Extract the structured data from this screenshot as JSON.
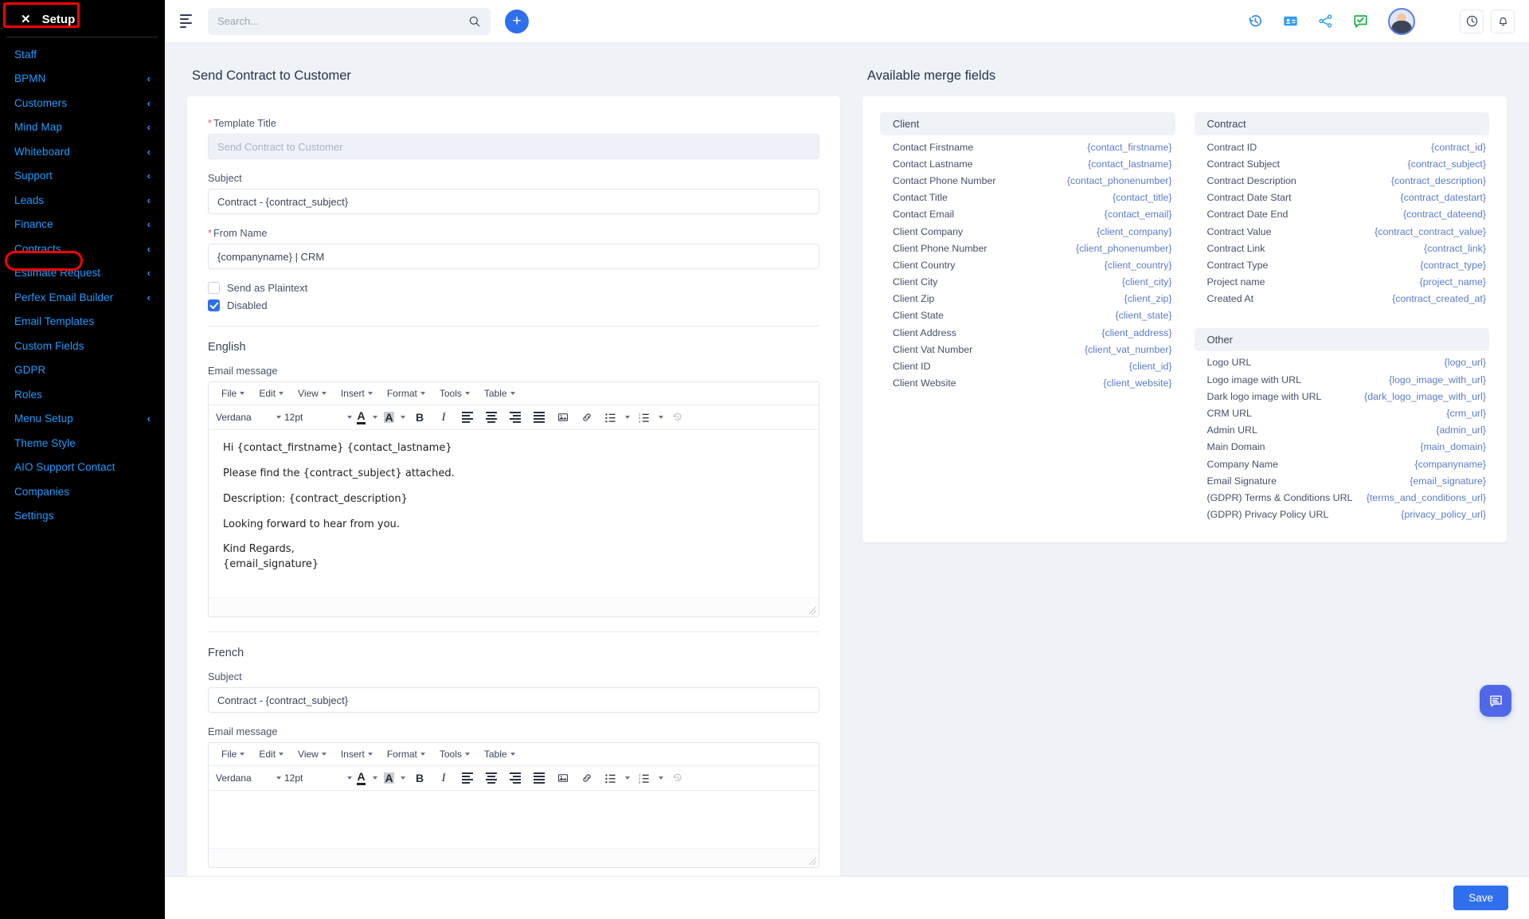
{
  "sidebar": {
    "header": {
      "label": "Setup",
      "close_icon": "close-icon"
    },
    "items": [
      {
        "label": "Staff",
        "has_chevron": false
      },
      {
        "label": "BPMN",
        "has_chevron": true
      },
      {
        "label": "Customers",
        "has_chevron": true
      },
      {
        "label": "Mind Map",
        "has_chevron": true
      },
      {
        "label": "Whiteboard",
        "has_chevron": true
      },
      {
        "label": "Support",
        "has_chevron": true
      },
      {
        "label": "Leads",
        "has_chevron": true
      },
      {
        "label": "Finance",
        "has_chevron": true
      },
      {
        "label": "Contracts",
        "has_chevron": true
      },
      {
        "label": "Estimate Request",
        "has_chevron": true
      },
      {
        "label": "Perfex Email Builder",
        "has_chevron": true
      },
      {
        "label": "Email Templates",
        "has_chevron": false
      },
      {
        "label": "Custom Fields",
        "has_chevron": false
      },
      {
        "label": "GDPR",
        "has_chevron": false
      },
      {
        "label": "Roles",
        "has_chevron": false
      },
      {
        "label": "Menu Setup",
        "has_chevron": true
      },
      {
        "label": "Theme Style",
        "has_chevron": false
      },
      {
        "label": "AIO Support Contact",
        "has_chevron": false
      },
      {
        "label": "Companies",
        "has_chevron": false
      },
      {
        "label": "Settings",
        "has_chevron": false
      }
    ],
    "chevron_glyph": "‹",
    "highlight_color": "#ff0000",
    "link_color": "#1e9bff",
    "background": "#000000"
  },
  "topbar": {
    "menu_toggle": "hamburger-icon",
    "search": {
      "placeholder": "Search...",
      "value": ""
    },
    "add_button_label": "+",
    "icons": [
      "history-icon",
      "contact-card-icon",
      "share-icon",
      "green-chat-icon",
      "avatar",
      "clock-icon",
      "bell-icon"
    ],
    "accent_color": "#2f6fed"
  },
  "main": {
    "page_title": "Send Contract to Customer",
    "form": {
      "template_title": {
        "label": "Template Title",
        "required": true,
        "value": "",
        "placeholder": "Send Contract to Customer",
        "disabled": true
      },
      "subject": {
        "label": "Subject",
        "required": false,
        "value": "Contract - {contract_subject}"
      },
      "from_name": {
        "label": "From Name",
        "required": true,
        "value": "{companyname} | CRM"
      },
      "checkboxes": [
        {
          "label": "Send as Plaintext",
          "checked": false
        },
        {
          "label": "Disabled",
          "checked": true
        }
      ]
    },
    "languages": [
      {
        "name": "English",
        "message_label": "Email message",
        "subject_label": "",
        "subject_value": "",
        "show_subject": false,
        "body": [
          "Hi {contact_firstname} {contact_lastname}",
          "Please find the {contract_subject} attached.",
          "Description: {contract_description}",
          "Looking forward to hear from you.",
          "Kind Regards,",
          "{email_signature}"
        ]
      },
      {
        "name": "French",
        "message_label": "Email message",
        "subject_label": "Subject",
        "subject_value": "Contract - {contract_subject}",
        "show_subject": true,
        "body": []
      }
    ],
    "editor": {
      "menus": [
        "File",
        "Edit",
        "View",
        "Insert",
        "Format",
        "Tools",
        "Table"
      ],
      "font_family": "Verdana",
      "font_size": "12pt",
      "buttons": [
        "text-color-icon",
        "background-color-icon",
        "bold-icon",
        "italic-icon",
        "align-left-icon",
        "align-center-icon",
        "align-right-icon",
        "align-justify-icon",
        "image-icon",
        "link-icon",
        "bullet-list-icon",
        "numbered-list-icon",
        "undo-icon"
      ]
    }
  },
  "merge_fields": {
    "title": "Available merge fields",
    "groups": [
      {
        "name": "Client",
        "column": 1,
        "rows": [
          {
            "name": "Contact Firstname",
            "key": "{contact_firstname}"
          },
          {
            "name": "Contact Lastname",
            "key": "{contact_lastname}"
          },
          {
            "name": "Contact Phone Number",
            "key": "{contact_phonenumber}"
          },
          {
            "name": "Contact Title",
            "key": "{contact_title}"
          },
          {
            "name": "Contact Email",
            "key": "{contact_email}"
          },
          {
            "name": "Client Company",
            "key": "{client_company}"
          },
          {
            "name": "Client Phone Number",
            "key": "{client_phonenumber}"
          },
          {
            "name": "Client Country",
            "key": "{client_country}"
          },
          {
            "name": "Client City",
            "key": "{client_city}"
          },
          {
            "name": "Client Zip",
            "key": "{client_zip}"
          },
          {
            "name": "Client State",
            "key": "{client_state}"
          },
          {
            "name": "Client Address",
            "key": "{client_address}"
          },
          {
            "name": "Client Vat Number",
            "key": "{client_vat_number}"
          },
          {
            "name": "Client ID",
            "key": "{client_id}"
          },
          {
            "name": "Client Website",
            "key": "{client_website}"
          }
        ]
      },
      {
        "name": "Contract",
        "column": 2,
        "rows": [
          {
            "name": "Contract ID",
            "key": "{contract_id}"
          },
          {
            "name": "Contract Subject",
            "key": "{contract_subject}"
          },
          {
            "name": "Contract Description",
            "key": "{contract_description}"
          },
          {
            "name": "Contract Date Start",
            "key": "{contract_datestart}"
          },
          {
            "name": "Contract Date End",
            "key": "{contract_dateend}"
          },
          {
            "name": "Contract Value",
            "key": "{contract_contract_value}"
          },
          {
            "name": "Contract Link",
            "key": "{contract_link}"
          },
          {
            "name": "Contract Type",
            "key": "{contract_type}"
          },
          {
            "name": "Project name",
            "key": "{project_name}"
          },
          {
            "name": "Created At",
            "key": "{contract_created_at}"
          }
        ]
      },
      {
        "name": "Other",
        "column": 2,
        "rows": [
          {
            "name": "Logo URL",
            "key": "{logo_url}"
          },
          {
            "name": "Logo image with URL",
            "key": "{logo_image_with_url}"
          },
          {
            "name": "Dark logo image with URL",
            "key": "{dark_logo_image_with_url}"
          },
          {
            "name": "CRM URL",
            "key": "{crm_url}"
          },
          {
            "name": "Admin URL",
            "key": "{admin_url}"
          },
          {
            "name": "Main Domain",
            "key": "{main_domain}"
          },
          {
            "name": "Company Name",
            "key": "{companyname}"
          },
          {
            "name": "Email Signature",
            "key": "{email_signature}"
          },
          {
            "name": "(GDPR) Terms & Conditions URL",
            "key": "{terms_and_conditions_url}"
          },
          {
            "name": "(GDPR) Privacy Policy URL",
            "key": "{privacy_policy_url}"
          }
        ]
      }
    ]
  },
  "footer": {
    "save_label": "Save"
  },
  "chat_fab": {
    "icon": "chat-bubble-icon",
    "color": "#5068e8"
  }
}
